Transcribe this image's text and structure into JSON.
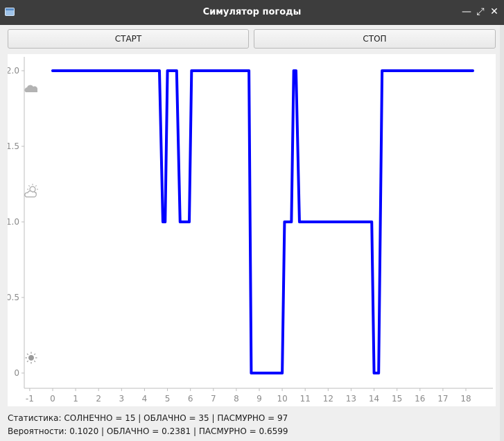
{
  "window": {
    "title": "Симулятор погоды",
    "min_glyph": "—",
    "max_glyph": "⤢",
    "close_glyph": "✕"
  },
  "toolbar": {
    "start_label": "СТАРТ",
    "stop_label": "СТОП"
  },
  "chart_data": {
    "type": "line",
    "color": "#0000ff",
    "xlim": [
      -1.4,
      18.8
    ],
    "ylim": [
      -0.1,
      2.15
    ],
    "x_ticks": [
      -1,
      0,
      1,
      2,
      3,
      4,
      5,
      6,
      7,
      8,
      9,
      10,
      11,
      12,
      13,
      14,
      15,
      16,
      17,
      18
    ],
    "x_tick_labels": [
      "-1",
      "0",
      "1",
      "2",
      "3",
      "4",
      "5",
      "6",
      "7",
      "8",
      "9",
      "10",
      "11",
      "12",
      "13",
      "14",
      "15",
      "16",
      "17",
      "18"
    ],
    "y_ticks": [
      0,
      0.5,
      1.0,
      1.5,
      2.0
    ],
    "y_tick_labels": [
      "0",
      "0.5",
      "1.0",
      "1.5",
      "2.0"
    ],
    "y_icons": [
      {
        "value": 0,
        "icon": "sun-icon"
      },
      {
        "value": 1,
        "icon": "partly-cloudy-icon"
      },
      {
        "value": 2,
        "icon": "cloud-icon"
      }
    ],
    "series": [
      {
        "x": [
          0,
          4.65,
          4.8,
          4.9,
          5.0,
          5.4,
          5.55,
          5.95,
          6.05,
          8.55,
          8.65,
          10.0,
          10.1,
          10.4,
          10.5,
          10.6,
          10.75,
          13.9,
          14.0,
          14.2,
          14.35,
          18.3
        ],
        "y": [
          2,
          2,
          1,
          1,
          2,
          2,
          1,
          1,
          2,
          2,
          0,
          0,
          1,
          1,
          2,
          2,
          1,
          1,
          0,
          0,
          2,
          2
        ]
      }
    ]
  },
  "stats": {
    "line1": "Статистика: СОЛНЕЧНО = 15 | ОБЛАЧНО = 35 | ПАСМУРНО = 97",
    "line2": "Вероятности: 0.1020 | ОБЛАЧНО = 0.2381 | ПАСМУРНО = 0.6599"
  }
}
